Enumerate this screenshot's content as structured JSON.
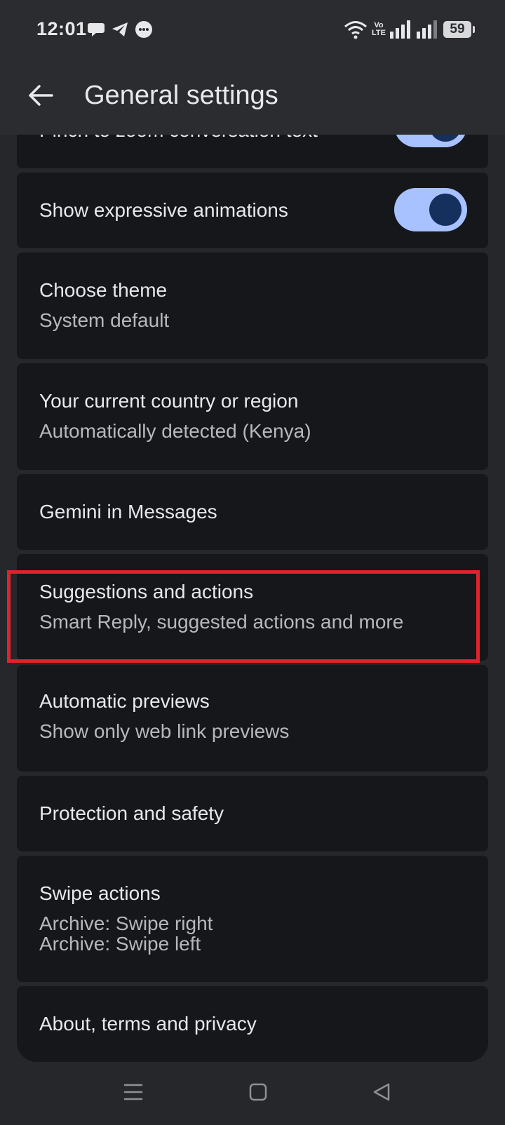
{
  "status_bar": {
    "time": "12:01",
    "network_label_top": "Vo",
    "network_label_bottom": "LTE",
    "battery_level": "59"
  },
  "app_bar": {
    "title": "General settings",
    "back_icon": "arrow-left-icon"
  },
  "settings": {
    "pinch_to_zoom": {
      "title": "Pinch to zoom conversation text",
      "enabled": true
    },
    "expressive_animations": {
      "title": "Show expressive animations",
      "enabled": true
    },
    "theme": {
      "title": "Choose theme",
      "value": "System default"
    },
    "country": {
      "title": "Your current country or region",
      "value": "Automatically detected (Kenya)"
    },
    "gemini": {
      "title": "Gemini in Messages"
    },
    "suggestions": {
      "title": "Suggestions and actions",
      "value": "Smart Reply, suggested actions and more"
    },
    "previews": {
      "title": "Automatic previews",
      "value": "Show only web link previews"
    },
    "protection": {
      "title": "Protection and safety"
    },
    "swipe": {
      "title": "Swipe actions",
      "value_right": "Archive: Swipe right",
      "value_left": "Archive: Swipe left"
    },
    "about": {
      "title": "About, terms and privacy"
    }
  },
  "colors": {
    "background": "#25272b",
    "card": "#16171b",
    "toggle_track": "#a8c1ff",
    "toggle_thumb": "#16305e",
    "highlight": "#e3202b"
  },
  "nav_bar": {
    "recents_icon": "menu-icon",
    "home_icon": "square-home-icon",
    "back_icon": "triangle-back-icon"
  }
}
